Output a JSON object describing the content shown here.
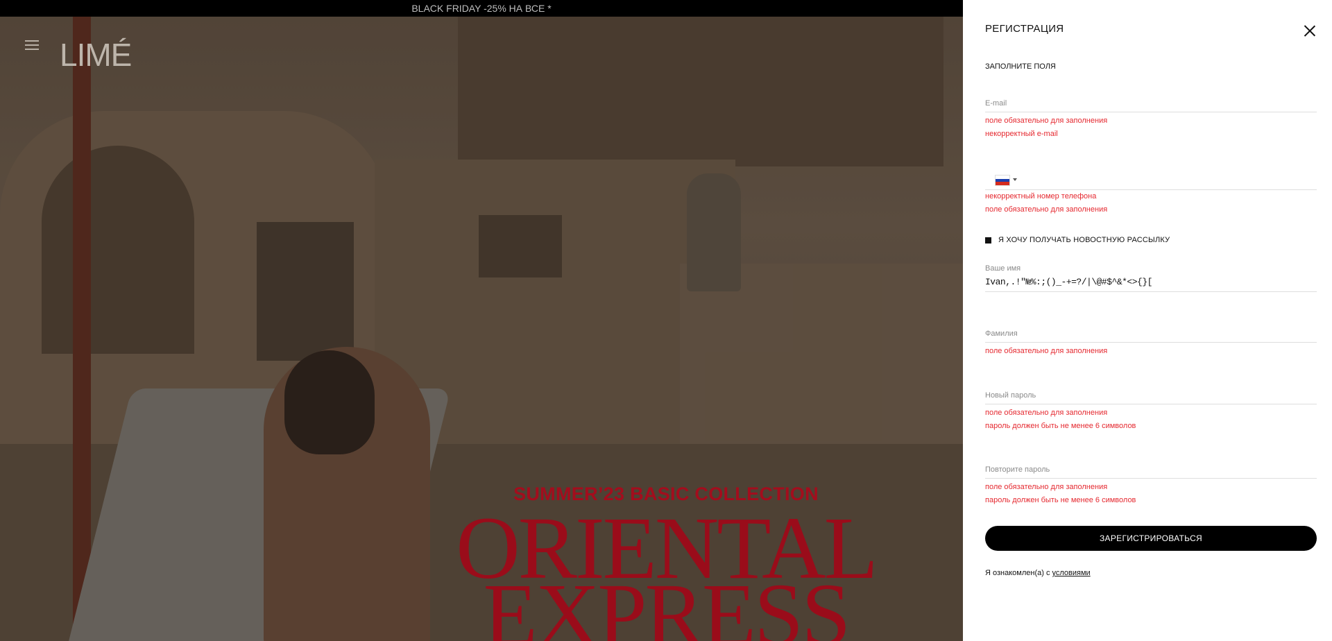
{
  "banner": {
    "text": "BLACK FRIDAY -25% НА ВСЕ *"
  },
  "header": {
    "logo": "LIMÉ"
  },
  "hero": {
    "subtitle": "SUMMER’23 BASIC COLLECTION",
    "title_line1": "ORIENTAL",
    "title_line2": "EXPRESS"
  },
  "registration": {
    "title": "РЕГИСТРАЦИЯ",
    "fill_hint": "ЗАПОЛНИТЕ ПОЛЯ",
    "email": {
      "label": "E-mail",
      "value": "",
      "errors": [
        "поле обязательно для заполнения",
        "некорректный e-mail"
      ]
    },
    "phone": {
      "country": "Russia",
      "value": "",
      "errors": [
        "некорректный номер телефона",
        "поле обязательно для заполнения"
      ]
    },
    "newsletter": {
      "label": "Я ХОЧУ ПОЛУЧАТЬ НОВОСТНУЮ РАССЫЛКУ",
      "checked": true
    },
    "first_name": {
      "label": "Ваше имя",
      "value": "Ivan,.!\"№%:;()_-+=?/|\\@#$^&*<>{}["
    },
    "last_name": {
      "label": "Фамилия",
      "value": "",
      "errors": [
        "поле обязательно для заполнения"
      ]
    },
    "new_password": {
      "label": "Новый пароль",
      "value": "",
      "errors": [
        "поле обязательно для заполнения",
        "пароль должен быть не менее 6 символов"
      ]
    },
    "repeat_password": {
      "label": "Повторите пароль",
      "value": "",
      "errors": [
        "поле обязательно для заполнения",
        "пароль должен быть не менее 6 символов"
      ]
    },
    "submit_label": "ЗАРЕГИСТРИРОВАТЬСЯ",
    "terms_text": "Я ознакомлен(а) с ",
    "terms_link": "условиями"
  },
  "colors": {
    "error": "#e5282f",
    "hero_text": "#9a0c1a",
    "panel_bg": "#ffffff",
    "banner_bg": "#000000"
  },
  "icons": {
    "menu": "hamburger-icon",
    "close": "close-icon",
    "flag": "russia-flag-icon",
    "dropdown": "chevron-down-icon"
  }
}
